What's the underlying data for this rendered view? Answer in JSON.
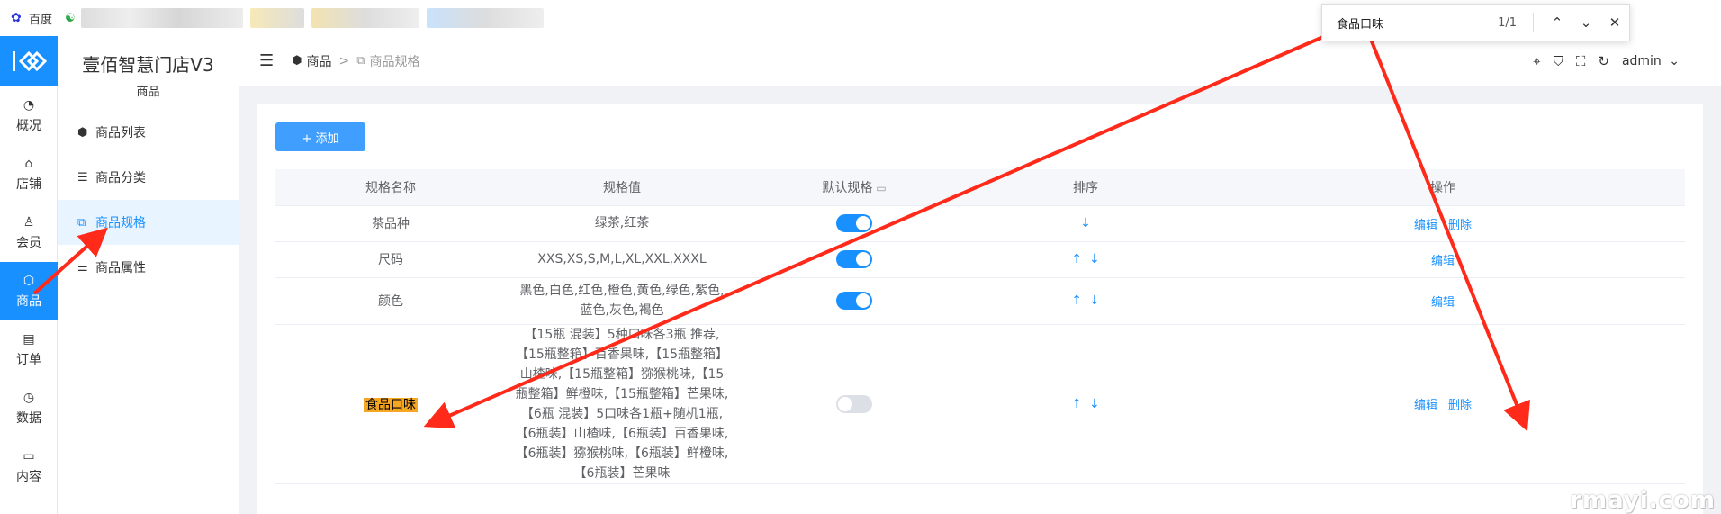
{
  "bookmarks": {
    "baidu_label": "百度"
  },
  "find_bar": {
    "query": "食品口味",
    "count": "1/1",
    "prev_icon": "chevron-up-icon",
    "next_icon": "chevron-down-icon",
    "close_icon": "close-icon"
  },
  "rail": {
    "items": [
      {
        "label": "概况",
        "icon": "dashboard-icon"
      },
      {
        "label": "店铺",
        "icon": "store-icon"
      },
      {
        "label": "会员",
        "icon": "user-icon"
      },
      {
        "label": "商品",
        "icon": "box-icon"
      },
      {
        "label": "订单",
        "icon": "clipboard-icon"
      },
      {
        "label": "数据",
        "icon": "clock-icon"
      },
      {
        "label": "内容",
        "icon": "folder-icon"
      }
    ],
    "active": "商品"
  },
  "submenu": {
    "brand": "壹佰智慧门店V3",
    "section": "商品",
    "items": [
      {
        "label": "商品列表",
        "icon": "cube-icon"
      },
      {
        "label": "商品分类",
        "icon": "list-icon"
      },
      {
        "label": "商品规格",
        "icon": "copy-icon"
      },
      {
        "label": "商品属性",
        "icon": "sliders-icon"
      }
    ],
    "active": "商品规格"
  },
  "header": {
    "breadcrumb_root": "商品",
    "breadcrumb_sep": ">",
    "breadcrumb_current": "商品规格",
    "user": "admin"
  },
  "toolbar": {
    "add_label": "+ 添加"
  },
  "table": {
    "columns": [
      "规格名称",
      "规格值",
      "默认规格",
      "排序",
      "操作"
    ],
    "rows": [
      {
        "name": "茶品种",
        "values": "绿茶,红茶",
        "default": true,
        "sort": [
          "↓"
        ],
        "actions": [
          "编辑",
          "删除"
        ]
      },
      {
        "name": "尺码",
        "values": "XXS,XS,S,M,L,XL,XXL,XXXL",
        "default": true,
        "sort": [
          "↑",
          "↓"
        ],
        "actions": [
          "编辑"
        ]
      },
      {
        "name": "颜色",
        "values": "黑色,白色,红色,橙色,黄色,绿色,紫色,蓝色,灰色,褐色",
        "default": true,
        "sort": [
          "↑",
          "↓"
        ],
        "actions": [
          "编辑"
        ]
      },
      {
        "name": "食品口味",
        "values": "【15瓶 混装】5种口味各3瓶 推荐,【15瓶整箱】百香果味,【15瓶整箱】山楂味,【15瓶整箱】猕猴桃味,【15瓶整箱】鲜橙味,【15瓶整箱】芒果味,【6瓶 混装】5口味各1瓶+随机1瓶,【6瓶装】山楂味,【6瓶装】百香果味,【6瓶装】猕猴桃味,【6瓶装】鲜橙味,【6瓶装】芒果味",
        "default": false,
        "sort": [
          "↑",
          "↓"
        ],
        "actions": [
          "编辑",
          "删除"
        ]
      }
    ]
  },
  "watermark": "rmayi.com",
  "colors": {
    "primary": "#1890ff",
    "highlight": "#f5a623",
    "arrow": "#ff2a1a"
  }
}
